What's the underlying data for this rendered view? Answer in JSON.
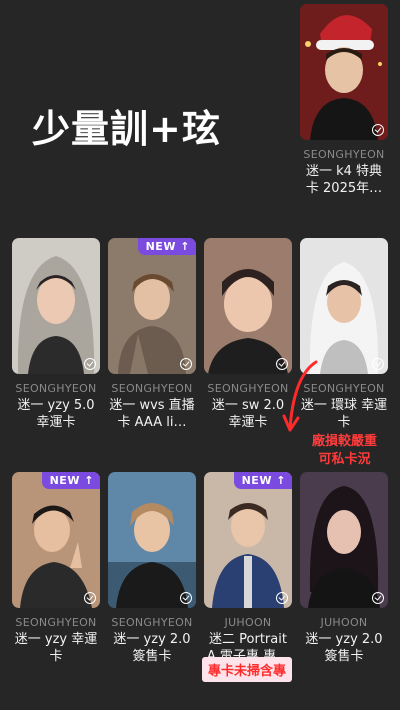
{
  "heading": "少量訓+玹",
  "badges": {
    "new": "NEW ↑"
  },
  "cards": [
    {
      "member": "SEONGHYEON",
      "name": "迷一 k4 特典卡 2025年…",
      "new": false,
      "photo_bg": "#7a2020"
    },
    {
      "member": "SEONGHYEON",
      "name": "迷一 yzy 5.0 幸運卡",
      "new": false,
      "photo_bg": "#b8b4ae"
    },
    {
      "member": "SEONGHYEON",
      "name": "迷一 wvs 直播卡 AAA li…",
      "new": true,
      "photo_bg": "#6f5e4e"
    },
    {
      "member": "SEONGHYEON",
      "name": "迷一 sw 2.0 幸運卡",
      "new": false,
      "photo_bg": "#8e6f60"
    },
    {
      "member": "SEONGHYEON",
      "name": "迷一 環球 幸運卡",
      "new": false,
      "photo_bg": "#d8d8d8"
    },
    {
      "member": "SEONGHYEON",
      "name": "迷一 yzy 幸運卡",
      "new": true,
      "photo_bg": "#a07b62"
    },
    {
      "member": "SEONGHYEON",
      "name": "迷一 yzy 2.0 簽售卡",
      "new": false,
      "photo_bg": "#4a6f8e"
    },
    {
      "member": "JUHOON",
      "name": "迷二 Portrait A 電子專 專…",
      "new": true,
      "photo_bg": "#2d3e6b"
    },
    {
      "member": "JUHOON",
      "name": "迷一 yzy 2.0 簽售卡",
      "new": false,
      "photo_bg": "#3a3040"
    }
  ],
  "notes": {
    "damage": "廠損較嚴重\n可私卡況",
    "album": "專卡未掃含專"
  },
  "colors": {
    "background": "#262626",
    "badge": "#7b4be0",
    "note_red": "#ff3b3b",
    "note_pink_bg": "#ffe3ea"
  }
}
